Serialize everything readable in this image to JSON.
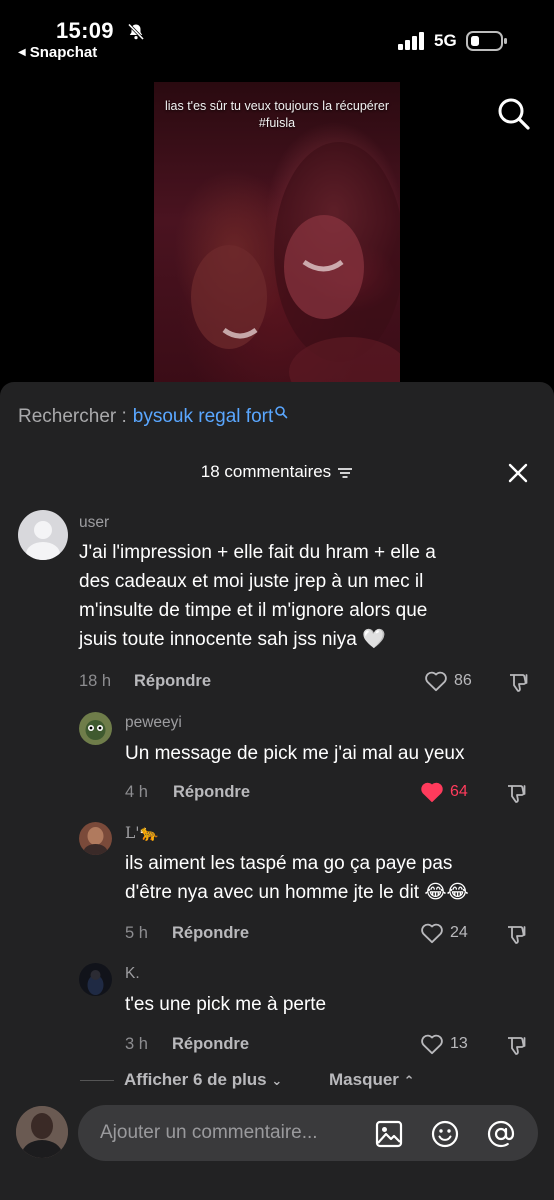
{
  "status_bar": {
    "time": "15:09",
    "back_app": "Snapchat",
    "network": "5G",
    "icons": [
      "bell-slash-icon",
      "signal-icon",
      "battery-icon"
    ]
  },
  "video": {
    "caption_line1": "lias t'es sûr tu veux toujours la récupérer",
    "caption_line2": "#fuisla"
  },
  "search": {
    "prefix": "Rechercher :",
    "term": "bysouk regal fort"
  },
  "comments_header": {
    "title": "18 commentaires"
  },
  "comments": [
    {
      "user": "user",
      "lines": [
        "J'ai l'impression + elle fait du hram + elle a",
        "des cadeaux et moi juste jrep à un mec il",
        "m'insulte de timpe et il m'ignore alors que",
        "jsuis toute innocente sah jss niya 🤍"
      ],
      "time": "18 h",
      "reply": "Répondre",
      "likes": "86",
      "liked": false
    },
    {
      "user": "peweeyi",
      "lines": [
        "Un message de pick me j'ai mal au yeux"
      ],
      "time": "4 h",
      "reply": "Répondre",
      "likes": "64",
      "liked": true
    },
    {
      "user": "L'🐆",
      "lines": [
        "ils aiment les taspé ma go ça paye pas",
        "d'être nya avec un homme jte le dit 😂😂"
      ],
      "time": "5 h",
      "reply": "Répondre",
      "likes": "24",
      "liked": false
    },
    {
      "user": "K.",
      "lines": [
        "t'es une pick me à perte"
      ],
      "time": "3 h",
      "reply": "Répondre",
      "likes": "13",
      "liked": false
    }
  ],
  "thread_controls": {
    "show_more": "Afficher 6 de plus",
    "hide": "Masquer"
  },
  "composer": {
    "placeholder": "Ajouter un commentaire..."
  },
  "colors": {
    "sheet_bg": "#222223",
    "link_blue": "#5aa7ff",
    "like_red": "#ff3b5c"
  }
}
